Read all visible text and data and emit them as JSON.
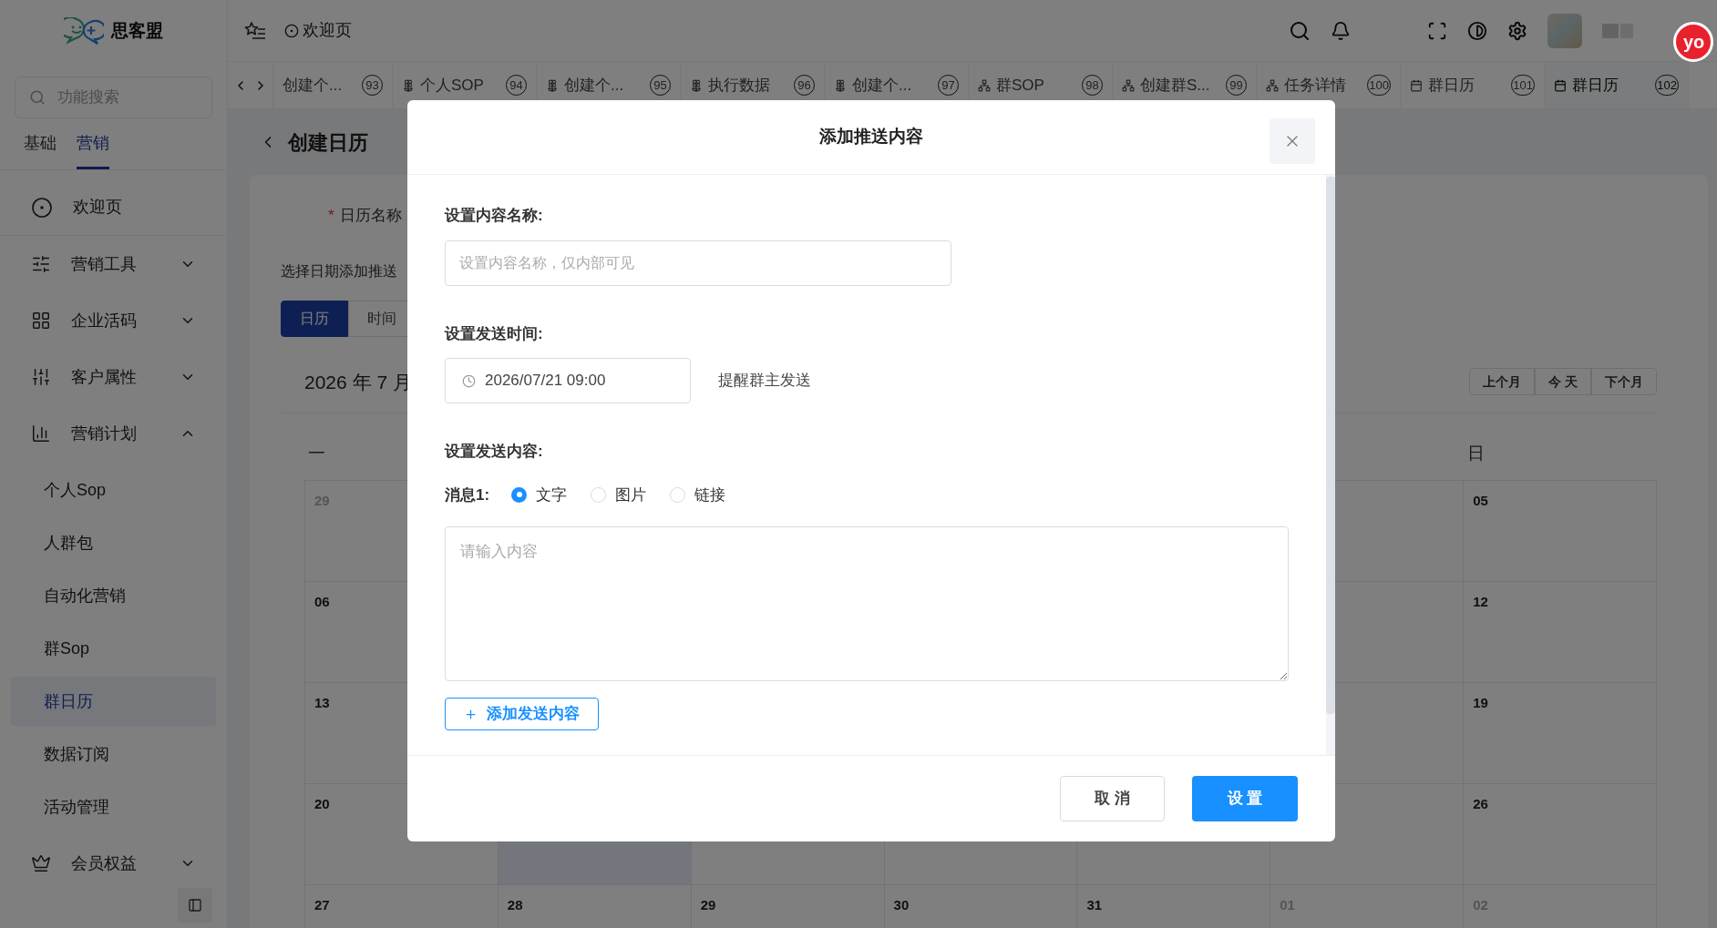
{
  "app": {
    "logo_text": "思客盟"
  },
  "header": {
    "breadcrumb": "欢迎页",
    "badge": "yo"
  },
  "tabs": [
    {
      "label": "创建个...",
      "number": "93",
      "selected": false
    },
    {
      "label": "个人SOP",
      "number": "94",
      "kind": "flower",
      "selected": false
    },
    {
      "label": "创建个...",
      "number": "95",
      "kind": "flower",
      "selected": false
    },
    {
      "label": "执行数据",
      "number": "96",
      "kind": "flower",
      "selected": false
    },
    {
      "label": "创建个...",
      "number": "97",
      "kind": "flower",
      "selected": false
    },
    {
      "label": "群SOP",
      "number": "98",
      "kind": "network",
      "selected": false
    },
    {
      "label": "创建群S...",
      "number": "99",
      "kind": "network",
      "selected": false
    },
    {
      "label": "任务详情",
      "number": "100",
      "kind": "network",
      "selected": false
    },
    {
      "label": "群日历",
      "number": "101",
      "kind": "calendar",
      "selected": false
    },
    {
      "label": "群日历",
      "number": "102",
      "kind": "calendar",
      "selected": true
    }
  ],
  "sidebar": {
    "search_placeholder": "功能搜索",
    "tabs": [
      {
        "label": "基础",
        "selected": false
      },
      {
        "label": "营销",
        "selected": true
      }
    ],
    "items": [
      {
        "label": "欢迎页",
        "kind": "home"
      },
      {
        "label": "营销工具",
        "kind": "sliders",
        "expanded": false
      },
      {
        "label": "企业活码",
        "kind": "grid",
        "expanded": false
      },
      {
        "label": "客户属性",
        "kind": "attrs",
        "expanded": false
      },
      {
        "label": "营销计划",
        "kind": "chart",
        "expanded": true,
        "children": [
          {
            "label": "个人Sop",
            "selected": false
          },
          {
            "label": "人群包",
            "selected": false
          },
          {
            "label": "自动化营销",
            "selected": false
          },
          {
            "label": "群Sop",
            "selected": false
          },
          {
            "label": "群日历",
            "selected": true
          },
          {
            "label": "数据订阅",
            "selected": false
          },
          {
            "label": "活动管理",
            "selected": false
          }
        ]
      },
      {
        "label": "会员权益",
        "kind": "crown",
        "expanded": false
      }
    ]
  },
  "page": {
    "title": "创建日历",
    "required_mark": "*",
    "name_label": "日历名称",
    "hint": "选择日期添加推送",
    "view_tabs": [
      {
        "label": "日历",
        "selected": true
      },
      {
        "label": "时间",
        "selected": false
      }
    ],
    "month": "2026 年 7 月",
    "nav_buttons": [
      "上个月",
      "今 天",
      "下个月"
    ],
    "weekdays": [
      "一",
      "日"
    ],
    "weeks": [
      [
        {
          "day": "29",
          "muted": true,
          "selected": false
        },
        {
          "day": "05",
          "muted": false,
          "selected": false
        }
      ],
      [
        {
          "day": "06",
          "muted": false,
          "selected": false
        },
        {
          "day": "12",
          "muted": false,
          "selected": false
        }
      ],
      [
        {
          "day": "13",
          "muted": false,
          "selected": false
        },
        {
          "day": "19",
          "muted": false,
          "selected": false
        }
      ],
      [
        {
          "day": "20",
          "muted": false,
          "selected": false
        },
        {
          "selected": true
        },
        {
          "day": "26",
          "muted": false,
          "selected": false
        }
      ],
      [
        {
          "day": "27",
          "muted": false,
          "selected": false
        },
        {
          "day": "28",
          "muted": false,
          "selected": false
        },
        {
          "day": "29",
          "muted": false,
          "selected": false
        },
        {
          "day": "30",
          "muted": false,
          "selected": false
        },
        {
          "day": "31",
          "muted": false,
          "selected": false
        },
        {
          "day": "01",
          "muted": true,
          "selected": false
        },
        {
          "day": "02",
          "muted": true,
          "selected": false
        }
      ]
    ]
  },
  "modal": {
    "title": "添加推送内容",
    "name_label": "设置内容名称:",
    "name_placeholder": "设置内容名称，仅内部可见",
    "time_label": "设置发送时间:",
    "time_value": "2026/07/21 09:00",
    "time_note": "提醒群主发送",
    "content_label": "设置发送内容:",
    "message_label": "消息1:",
    "types": [
      {
        "label": "文字",
        "selected": true
      },
      {
        "label": "图片",
        "selected": false
      },
      {
        "label": "链接",
        "selected": false
      }
    ],
    "content_placeholder": "请输入内容",
    "add_button": "添加发送内容",
    "cancel_button": "取 消",
    "ok_button": "设 置"
  }
}
